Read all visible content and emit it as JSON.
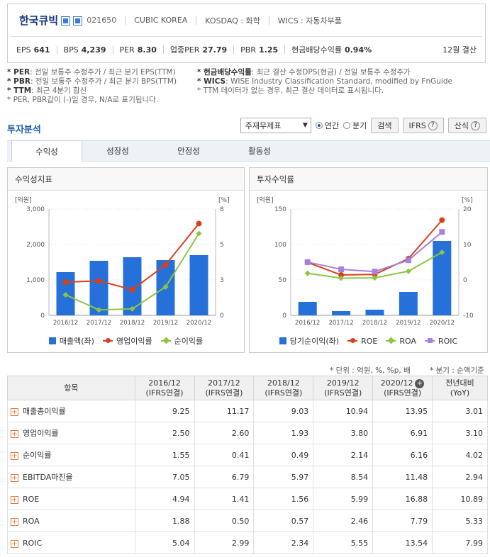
{
  "header": {
    "company_name": "한국큐빅",
    "code": "021650",
    "eng_name": "CUBIC KOREA",
    "market": "KOSDAQ : 화학",
    "wics": "WICS : 자동차부품",
    "stats": [
      {
        "label": "EPS",
        "value": "641"
      },
      {
        "label": "BPS",
        "value": "4,239"
      },
      {
        "label": "PER",
        "value": "8.30"
      },
      {
        "label": "업종PER",
        "value": "27.79"
      },
      {
        "label": "PBR",
        "value": "1.25"
      },
      {
        "label": "현금배당수익률",
        "value": "0.94%"
      }
    ],
    "settlement": "12월 결산"
  },
  "notes": {
    "left": [
      {
        "key": "* PER",
        "text": ": 전일 보통주 수정주가 / 최근 분기 EPS(TTM)"
      },
      {
        "key": "* PBR",
        "text": ": 전일 보통주 수정주가 / 최근 분기 BPS(TTM)"
      },
      {
        "key": "* TTM",
        "text": ": 최근 4분기 합산"
      },
      {
        "key": "",
        "text": "* PER, PBR값이 (-)일 경우, N/A로 표기됩니다."
      }
    ],
    "right": [
      {
        "key": "* 현금배당수익률",
        "text": ": 최근 결산 수정DPS(현금) / 전일 보통주 수정주가"
      },
      {
        "key": "* WICS",
        "text": ": WISE Industry Classification Standard, modified by FnGuide"
      },
      {
        "key": "",
        "text": "* TTM 데이터가 없는 경우, 최근 결산 데이터로 표시됩니다."
      }
    ]
  },
  "section": {
    "title": "투자분석",
    "select_value": "주재무제표",
    "radio_annual": "연간",
    "radio_quarter": "분기",
    "search_btn": "검색",
    "ifrs_btn": "IFRS",
    "formula_btn": "산식"
  },
  "tabs": [
    "수익성",
    "성장성",
    "안정성",
    "활동성"
  ],
  "chart_data": [
    {
      "type": "bar+line",
      "panel_title": "수익성지표",
      "left_unit": "[억원]",
      "right_unit": "[%]",
      "categories": [
        "2016/12",
        "2017/12",
        "2018/12",
        "2019/12",
        "2020/12"
      ],
      "ylim_left": [
        0,
        3000
      ],
      "left_ticks": [
        "0",
        "1,000",
        "2,000",
        "3,000"
      ],
      "ylim_right": [
        0,
        8
      ],
      "right_ticks": [
        "0",
        "3",
        "5",
        "8"
      ],
      "series": [
        {
          "name": "매출액(좌)",
          "kind": "bar",
          "axis": "left",
          "color": "#2670d9",
          "values": [
            1220,
            1540,
            1640,
            1560,
            1700
          ]
        },
        {
          "name": "영업이익률",
          "kind": "line",
          "axis": "right",
          "color": "#d9401a",
          "values": [
            2.5,
            2.6,
            1.93,
            3.8,
            6.91
          ]
        },
        {
          "name": "순이익률",
          "kind": "line",
          "axis": "right",
          "color": "#8cc63f",
          "values": [
            1.55,
            0.41,
            0.49,
            2.14,
            6.16
          ]
        }
      ]
    },
    {
      "type": "bar+line",
      "panel_title": "투자수익률",
      "left_unit": "[억원]",
      "right_unit": "[%]",
      "categories": [
        "2016/12",
        "2017/12",
        "2018/12",
        "2019/12",
        "2020/12"
      ],
      "ylim_left": [
        0,
        150
      ],
      "left_ticks": [
        "0",
        "50",
        "100",
        "150"
      ],
      "ylim_right": [
        -10,
        20
      ],
      "right_ticks": [
        "-10",
        "0",
        "10",
        "20"
      ],
      "series": [
        {
          "name": "당기순이익(좌)",
          "kind": "bar",
          "axis": "left",
          "color": "#2670d9",
          "values": [
            19,
            6,
            8,
            33,
            105
          ]
        },
        {
          "name": "ROE",
          "kind": "line",
          "axis": "right",
          "color": "#d9401a",
          "values": [
            4.94,
            1.41,
            1.56,
            5.99,
            16.88
          ]
        },
        {
          "name": "ROA",
          "kind": "line",
          "axis": "right",
          "color": "#8cc63f",
          "values": [
            1.88,
            0.5,
            0.57,
            2.46,
            7.79
          ]
        },
        {
          "name": "ROIC",
          "kind": "line",
          "axis": "right",
          "color": "#a67fe0",
          "values": [
            5.04,
            2.99,
            2.34,
            5.55,
            13.54
          ]
        }
      ]
    }
  ],
  "table": {
    "unit_note": "* 단위 : 억원, %, %p, 배",
    "period_note": "* 분기 : 순액기준",
    "headers": [
      {
        "top": "항목",
        "sub": ""
      },
      {
        "top": "2016/12",
        "sub": "(IFRS연결)"
      },
      {
        "top": "2017/12",
        "sub": "(IFRS연결)"
      },
      {
        "top": "2018/12",
        "sub": "(IFRS연결)"
      },
      {
        "top": "2019/12",
        "sub": "(IFRS연결)"
      },
      {
        "top": "2020/12",
        "sub": "(IFRS연결)"
      },
      {
        "top": "전년대비",
        "sub": "(YoY)"
      }
    ],
    "rows": [
      {
        "item": "매출총이익률",
        "values": [
          "9.25",
          "11.17",
          "9.03",
          "10.94",
          "13.95",
          "3.01"
        ]
      },
      {
        "item": "영업이익률",
        "values": [
          "2.50",
          "2.60",
          "1.93",
          "3.80",
          "6.91",
          "3.10"
        ]
      },
      {
        "item": "순이익률",
        "values": [
          "1.55",
          "0.41",
          "0.49",
          "2.14",
          "6.16",
          "4.02"
        ]
      },
      {
        "item": "EBITDA마진율",
        "values": [
          "7.05",
          "6.79",
          "5.97",
          "8.54",
          "11.48",
          "2.94"
        ]
      },
      {
        "item": "ROE",
        "values": [
          "4.94",
          "1.41",
          "1.56",
          "5.99",
          "16.88",
          "10.89"
        ]
      },
      {
        "item": "ROA",
        "values": [
          "1.88",
          "0.50",
          "0.57",
          "2.46",
          "7.79",
          "5.33"
        ]
      },
      {
        "item": "ROIC",
        "values": [
          "5.04",
          "2.99",
          "2.34",
          "5.55",
          "13.54",
          "7.99"
        ]
      }
    ]
  }
}
